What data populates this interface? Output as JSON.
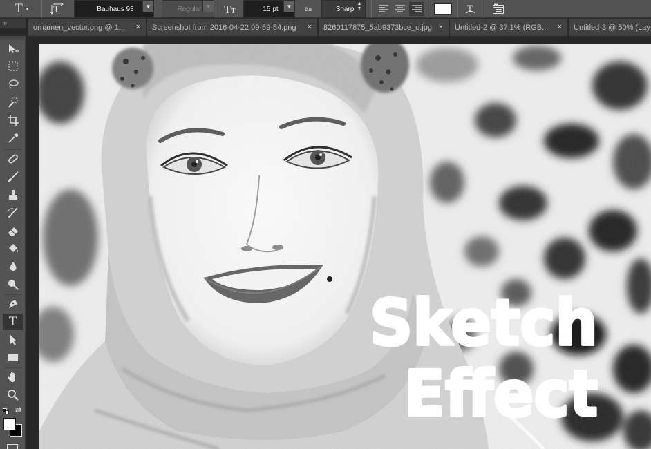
{
  "options_bar": {
    "tool_icon": "type-tool-icon",
    "font_family": "Bauhaus 93",
    "font_style": "Regular",
    "font_size_icon": "font-size-icon",
    "font_size": "15 pt",
    "antialias_icon": "antialias-icon",
    "antialias": "Sharp",
    "align_icons": [
      "align-left-icon",
      "align-center-icon",
      "align-right-icon"
    ],
    "text_color": "#ffffff",
    "warp_icon": "warp-text-icon",
    "panels_icon": "character-panel-icon"
  },
  "tabs": [
    {
      "label": "ornamen_vector.png @ 1..."
    },
    {
      "label": "Screenshot from 2016-04-22 09-59-54.png"
    },
    {
      "label": "8260117875_5ab9373bce_o.jpg"
    },
    {
      "label": "Untitled-2 @ 37,1% (RGB..."
    },
    {
      "label": "Untitled-3 @ 50% (Lay"
    }
  ],
  "tab_close_glyph": "×",
  "tools_collapse": "»",
  "tools": [
    "move-tool-icon",
    "marquee-tool-icon",
    "lasso-tool-icon",
    "quick-selection-tool-icon",
    "crop-tool-icon",
    "eyedropper-tool-icon",
    "healing-brush-tool-icon",
    "brush-tool-icon",
    "clone-stamp-tool-icon",
    "history-brush-tool-icon",
    "eraser-tool-icon",
    "paint-bucket-tool-icon",
    "blur-tool-icon",
    "dodge-tool-icon",
    "pen-tool-icon",
    "type-tool-icon",
    "path-selection-tool-icon",
    "rectangle-tool-icon",
    "hand-tool-icon",
    "zoom-tool-icon"
  ],
  "active_tool": "type-tool-icon",
  "foreground_color": "#ffffff",
  "background_color": "#000000",
  "canvas_text": {
    "line1": "Sketch",
    "line2": "Effect"
  },
  "ui_colors": {
    "panel": "#535353",
    "dark": "#282828",
    "tab": "#424242"
  }
}
